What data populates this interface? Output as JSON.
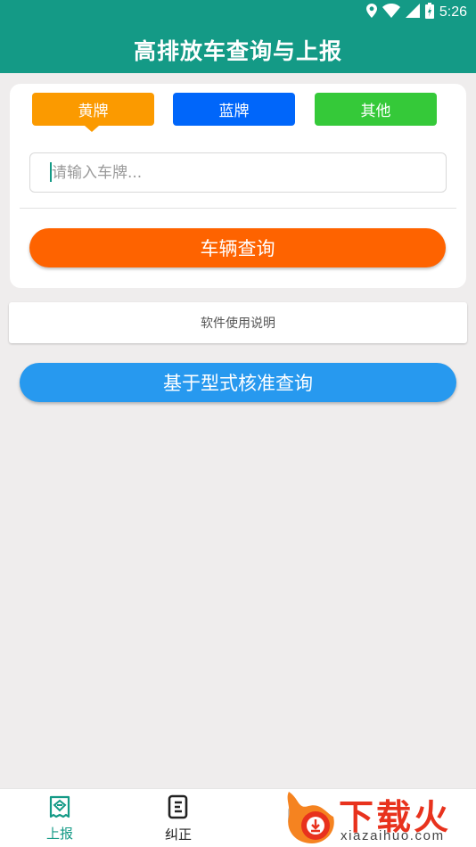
{
  "status_bar": {
    "time": "5:26"
  },
  "header": {
    "title": "高排放车查询与上报"
  },
  "plate_tabs": [
    {
      "label": "黄牌",
      "color": "#fb9a00",
      "selected": true
    },
    {
      "label": "蓝牌",
      "color": "#0066fa",
      "selected": false
    },
    {
      "label": "其他",
      "color": "#35c939",
      "selected": false
    }
  ],
  "search": {
    "placeholder": "请输入车牌...",
    "value": ""
  },
  "query_button": {
    "label": "车辆查询",
    "color": "#fe6300"
  },
  "instructions": {
    "label": "软件使用说明"
  },
  "type_query_button": {
    "label": "基于型式核准查询",
    "color": "#2799ef"
  },
  "bottom_nav": {
    "items": [
      {
        "label": "上报",
        "icon": "report-icon",
        "active": true,
        "color": "#149a86"
      },
      {
        "label": "纠正",
        "icon": "correct-icon",
        "active": false,
        "color": "#222222"
      },
      {
        "label": "",
        "icon": "faded-icon",
        "active": false,
        "color": "#bbbbbb"
      }
    ]
  },
  "watermark": {
    "brand": "下载火",
    "domain": "xiazaihuo.com"
  },
  "colors": {
    "header": "#149a86",
    "background": "#efeded"
  }
}
